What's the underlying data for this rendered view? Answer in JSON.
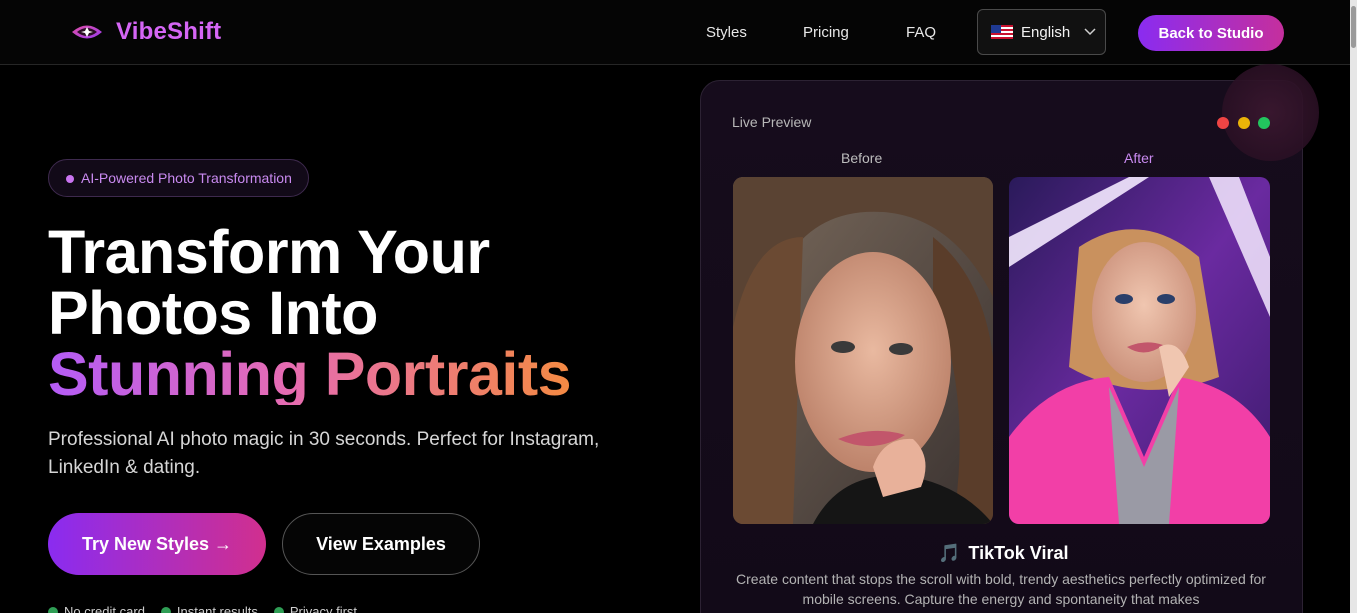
{
  "header": {
    "brand": "VibeShift",
    "nav": [
      "Styles",
      "Pricing",
      "FAQ"
    ],
    "language": "English",
    "cta": "Back to Studio"
  },
  "hero": {
    "badge": "AI-Powered Photo Transformation",
    "title_line1": "Transform Your",
    "title_line2": "Photos Into",
    "title_line3": "Stunning Portraits",
    "subtitle": "Professional AI photo magic in 30 seconds. Perfect for Instagram, LinkedIn & dating.",
    "primary_button": "Try New Styles →",
    "secondary_button": "View Examples",
    "features": [
      "No credit card",
      "Instant results",
      "Privacy first"
    ]
  },
  "preview": {
    "title": "Live Preview",
    "before_label": "Before",
    "after_label": "After",
    "style_icon": "🎵",
    "style_name": "TikTok Viral",
    "style_description": "Create content that stops the scroll with bold, trendy aesthetics perfectly optimized for mobile screens. Capture the energy and spontaneity that makes"
  },
  "colors": {
    "accent": "#8a2cf0",
    "accent_pink": "#d12f8e",
    "gradient_orange": "#f48a43",
    "dot_red": "#ef4444",
    "dot_yellow": "#eab308",
    "dot_green": "#22c55e"
  }
}
